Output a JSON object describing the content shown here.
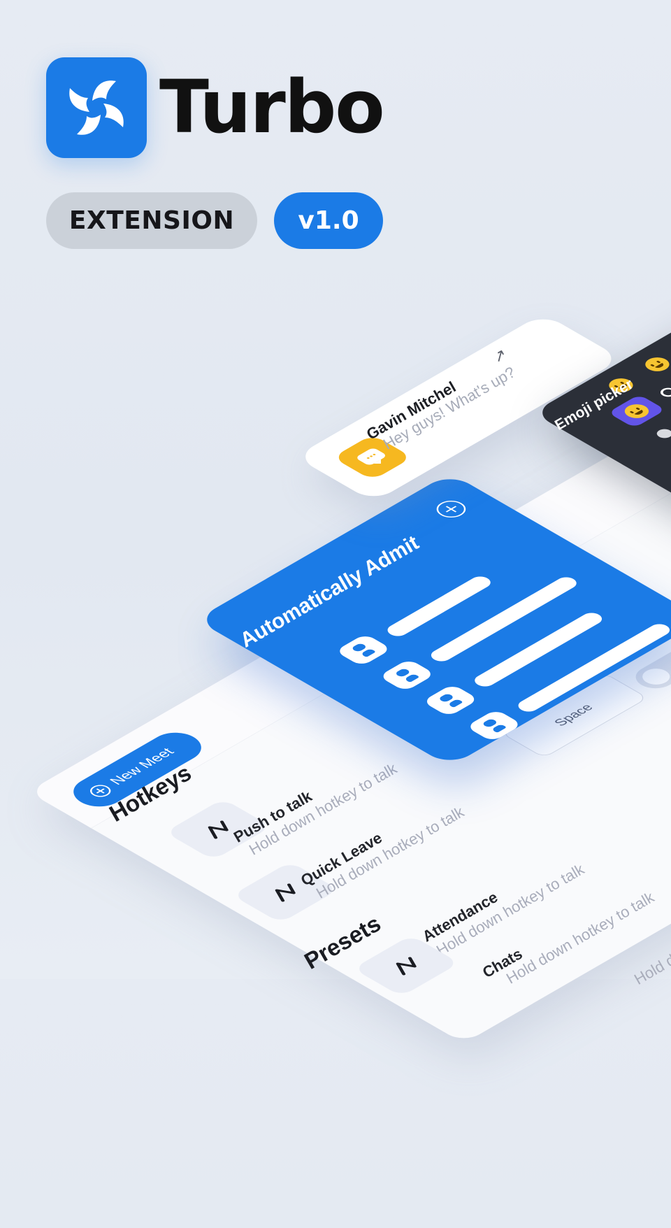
{
  "brand": {
    "name": "Turbo",
    "badge_type": "EXTENSION",
    "version": "v1.0",
    "accent_color": "#1b7be6"
  },
  "main_panel": {
    "new_meet_label": "New Meet",
    "hotkeys": {
      "title": "Hotkeys",
      "items": [
        {
          "icon": "hotkey-icon",
          "title": "Push to talk",
          "subtitle": "Hold down hotkey to talk",
          "key": "Space"
        },
        {
          "icon": "hotkey-icon",
          "title": "Quick Leave",
          "subtitle": "Hold down hotkey to talk"
        }
      ]
    },
    "presets": {
      "title": "Presets",
      "items": [
        {
          "icon": "hotkey-icon",
          "title": "Attendance",
          "subtitle": "Hold down hotkey to talk"
        },
        {
          "icon": "hotkey-icon",
          "title": "Chats",
          "subtitle": "Hold down hotkey to talk"
        }
      ]
    },
    "partial_text": "Hold down hotkey"
  },
  "admit_card": {
    "title": "Automatically Admit",
    "icon": "add-circle-icon",
    "rows": 4
  },
  "blue_card": {
    "partial_text": "a"
  },
  "message_card": {
    "sender": "Gavin Mitchel",
    "text": "Hey guys! What's up?",
    "avatar_color": "#f6b820",
    "icon": "arrow-up-right-icon"
  },
  "emoji_picker": {
    "title": "Emoji picker"
  }
}
